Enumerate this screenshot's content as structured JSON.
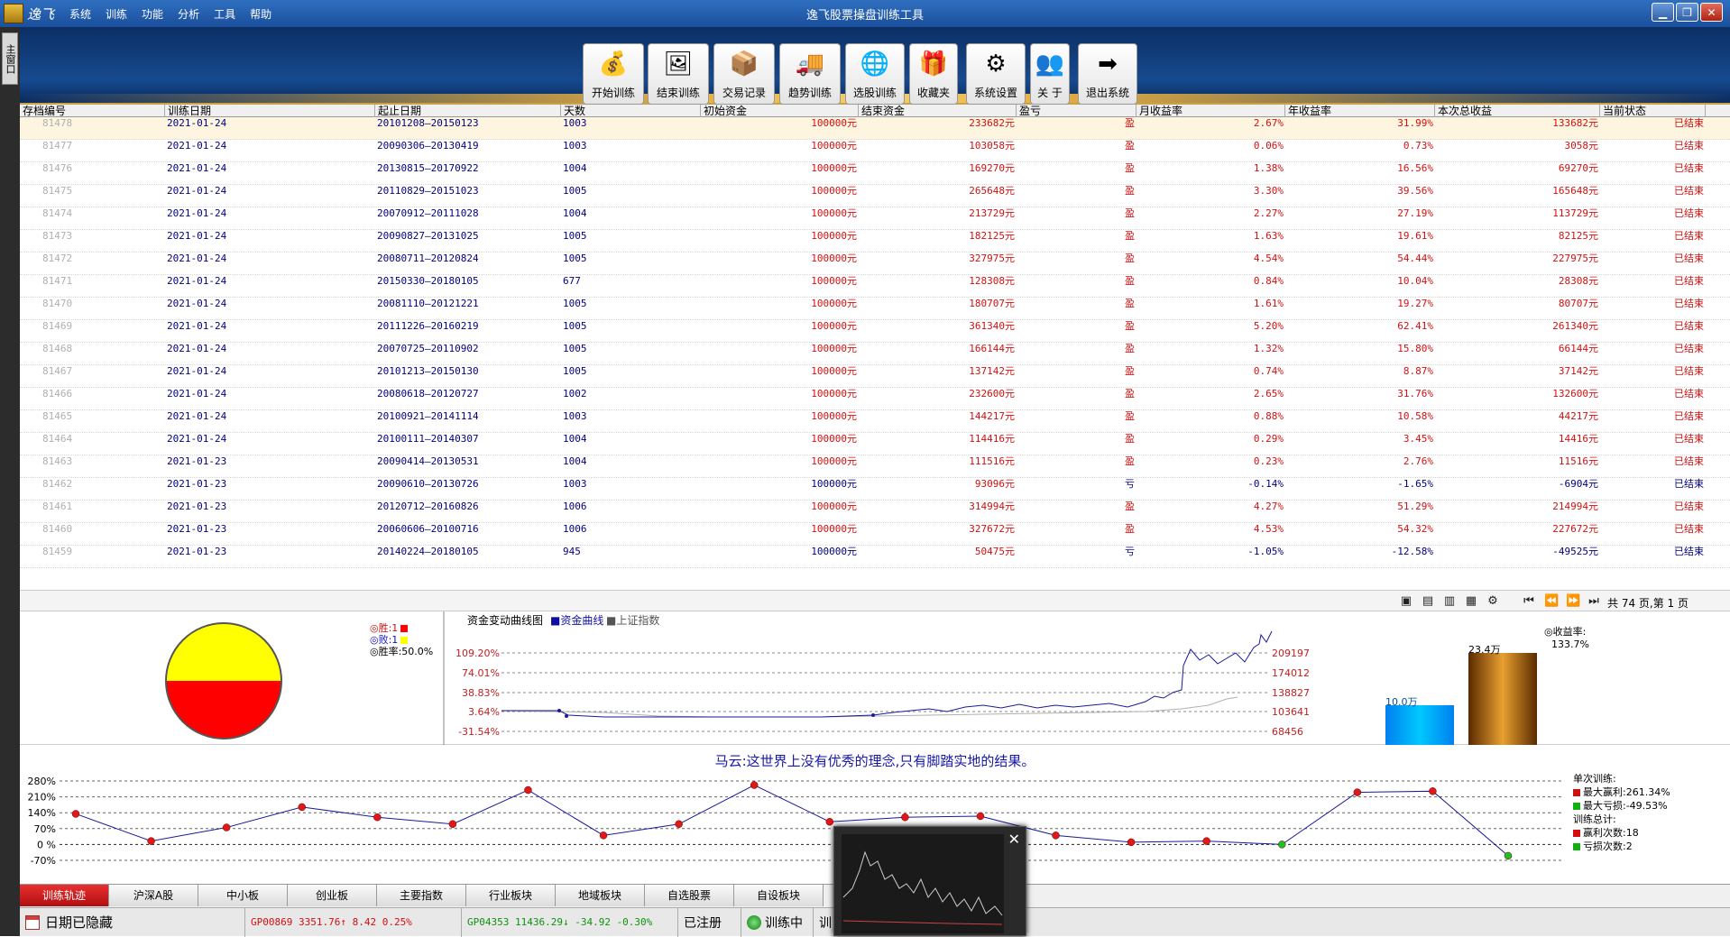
{
  "app": {
    "brand": "逸飞",
    "title": "逸飞股票操盘训练工具",
    "menu": [
      "系统",
      "训练",
      "功能",
      "分析",
      "工具",
      "帮助"
    ],
    "window_buttons": [
      "minimize",
      "restore",
      "close"
    ]
  },
  "left_tab": "主窗口",
  "toolbar": [
    {
      "label": "开始训练",
      "icon": "coins-icon",
      "glyph": "💰"
    },
    {
      "label": "结束训练",
      "icon": "picture-frame-icon",
      "glyph": "🖼"
    },
    {
      "label": "交易记录",
      "icon": "box-icon",
      "glyph": "📦"
    },
    {
      "label": "趋势训练",
      "icon": "truck-icon",
      "glyph": "🚚"
    },
    {
      "label": "选股训练",
      "icon": "globe-icon",
      "glyph": "🌐"
    },
    {
      "label": "收藏夹",
      "icon": "sparkle-box-icon",
      "glyph": "🎁"
    },
    {
      "label": "系统设置",
      "icon": "gear-icon",
      "glyph": "⚙"
    },
    {
      "label": "关 于",
      "icon": "people-icon",
      "glyph": "👥"
    },
    {
      "label": "退出系统",
      "icon": "arrow-right-icon",
      "glyph": "➡"
    }
  ],
  "table": {
    "columns": [
      "存档编号",
      "训练日期",
      "起止日期",
      "天数",
      "初始资金",
      "结束资金",
      "盈亏",
      "月收益率",
      "年收益率",
      "本次总收益",
      "当前状态"
    ],
    "rows": [
      [
        "81478",
        "2021-01-24",
        "20101208—20150123",
        "1003",
        "100000元",
        "233682元",
        "盈",
        "2.67%",
        "31.99%",
        "133682元",
        "已结束"
      ],
      [
        "81477",
        "2021-01-24",
        "20090306—20130419",
        "1003",
        "100000元",
        "103058元",
        "盈",
        "0.06%",
        "0.73%",
        "3058元",
        "已结束"
      ],
      [
        "81476",
        "2021-01-24",
        "20130815—20170922",
        "1004",
        "100000元",
        "169270元",
        "盈",
        "1.38%",
        "16.56%",
        "69270元",
        "已结束"
      ],
      [
        "81475",
        "2021-01-24",
        "20110829—20151023",
        "1005",
        "100000元",
        "265648元",
        "盈",
        "3.30%",
        "39.56%",
        "165648元",
        "已结束"
      ],
      [
        "81474",
        "2021-01-24",
        "20070912—20111028",
        "1004",
        "100000元",
        "213729元",
        "盈",
        "2.27%",
        "27.19%",
        "113729元",
        "已结束"
      ],
      [
        "81473",
        "2021-01-24",
        "20090827—20131025",
        "1005",
        "100000元",
        "182125元",
        "盈",
        "1.63%",
        "19.61%",
        "82125元",
        "已结束"
      ],
      [
        "81472",
        "2021-01-24",
        "20080711—20120824",
        "1005",
        "100000元",
        "327975元",
        "盈",
        "4.54%",
        "54.44%",
        "227975元",
        "已结束"
      ],
      [
        "81471",
        "2021-01-24",
        "20150330—20180105",
        "677",
        "100000元",
        "128308元",
        "盈",
        "0.84%",
        "10.04%",
        "28308元",
        "已结束"
      ],
      [
        "81470",
        "2021-01-24",
        "20081110—20121221",
        "1005",
        "100000元",
        "180707元",
        "盈",
        "1.61%",
        "19.27%",
        "80707元",
        "已结束"
      ],
      [
        "81469",
        "2021-01-24",
        "20111226—20160219",
        "1005",
        "100000元",
        "361340元",
        "盈",
        "5.20%",
        "62.41%",
        "261340元",
        "已结束"
      ],
      [
        "81468",
        "2021-01-24",
        "20070725—20110902",
        "1005",
        "100000元",
        "166144元",
        "盈",
        "1.32%",
        "15.80%",
        "66144元",
        "已结束"
      ],
      [
        "81467",
        "2021-01-24",
        "20101213—20150130",
        "1005",
        "100000元",
        "137142元",
        "盈",
        "0.74%",
        "8.87%",
        "37142元",
        "已结束"
      ],
      [
        "81466",
        "2021-01-24",
        "20080618—20120727",
        "1002",
        "100000元",
        "232600元",
        "盈",
        "2.65%",
        "31.76%",
        "132600元",
        "已结束"
      ],
      [
        "81465",
        "2021-01-24",
        "20100921—20141114",
        "1003",
        "100000元",
        "144217元",
        "盈",
        "0.88%",
        "10.58%",
        "44217元",
        "已结束"
      ],
      [
        "81464",
        "2021-01-24",
        "20100111—20140307",
        "1004",
        "100000元",
        "114416元",
        "盈",
        "0.29%",
        "3.45%",
        "14416元",
        "已结束"
      ],
      [
        "81463",
        "2021-01-23",
        "20090414—20130531",
        "1004",
        "100000元",
        "111516元",
        "盈",
        "0.23%",
        "2.76%",
        "11516元",
        "已结束"
      ],
      [
        "81462",
        "2021-01-23",
        "20090610—20130726",
        "1003",
        "100000元",
        "93096元",
        "亏",
        "-0.14%",
        "-1.65%",
        "-6904元",
        "已结束"
      ],
      [
        "81461",
        "2021-01-23",
        "20120712—20160826",
        "1006",
        "100000元",
        "314994元",
        "盈",
        "4.27%",
        "51.29%",
        "214994元",
        "已结束"
      ],
      [
        "81460",
        "2021-01-23",
        "20060606—20100716",
        "1006",
        "100000元",
        "327672元",
        "盈",
        "4.53%",
        "54.32%",
        "227672元",
        "已结束"
      ],
      [
        "81459",
        "2021-01-23",
        "20140224—20180105",
        "945",
        "100000元",
        "50475元",
        "亏",
        "-1.05%",
        "-12.58%",
        "-49525元",
        "已结束"
      ]
    ]
  },
  "pager": {
    "info": "共 74 页,第 1 页"
  },
  "winloss": {
    "win_label": "◎胜:1",
    "loss_label": "◎败:1",
    "rate_label": "◎胜率:50.0%",
    "win_color": "#ff0000",
    "loss_color": "#ffff00"
  },
  "capital_chart": {
    "title": "资金变动曲线图",
    "legend_fund": "■资金曲线",
    "legend_index": "■上证指数",
    "left_ticks": [
      "109.20%",
      "74.01%",
      "38.83%",
      "3.64%",
      "-31.54%"
    ],
    "right_ticks": [
      "209197",
      "174012",
      "138827",
      "103641",
      "68456"
    ]
  },
  "bars": {
    "left_label": "10.0万",
    "right_label": "23.4万",
    "left_value": 10.0,
    "right_value": 23.4,
    "rate_title": "◎收益率:",
    "rate_value": "133.7%"
  },
  "motto": "马云:这世界上没有优秀的理念,只有脚踏实地的结果。",
  "chart_data": {
    "type": "line",
    "title": "",
    "y_ticks": [
      "280%",
      "210%",
      "140%",
      "70%",
      "0 %",
      "-70%"
    ],
    "ylim": [
      -70,
      280
    ],
    "values": [
      135,
      15,
      75,
      165,
      120,
      90,
      240,
      40,
      90,
      262,
      100,
      120,
      125,
      40,
      10,
      15,
      0,
      230,
      235,
      -50
    ],
    "point_colors": [
      "red",
      "red",
      "red",
      "red",
      "red",
      "red",
      "red",
      "red",
      "red",
      "red",
      "red",
      "red",
      "red",
      "red",
      "red",
      "red",
      "green",
      "red",
      "red",
      "green"
    ]
  },
  "track_side": {
    "single_title": "单次训练:",
    "max_profit": "最大赢利:261.34%",
    "max_loss": "最大亏损:-49.53%",
    "total_title": "训练总计:",
    "win_count": "赢利次数:18",
    "loss_count": "亏损次数:2"
  },
  "bottom_tabs": [
    "训练轨迹",
    "沪深A股",
    "中小板",
    "创业板",
    "主要指数",
    "行业板块",
    "地域板块",
    "自选股票",
    "自设板块"
  ],
  "status": {
    "date_hidden": "日期已隐藏",
    "sh_index": "GP00869  3351.76↑  8.42  0.25%",
    "sz_index": "GP04353  11436.29↓  -34.92  -0.30%",
    "registered": "已注册",
    "training": "训练中",
    "extra": "训"
  }
}
